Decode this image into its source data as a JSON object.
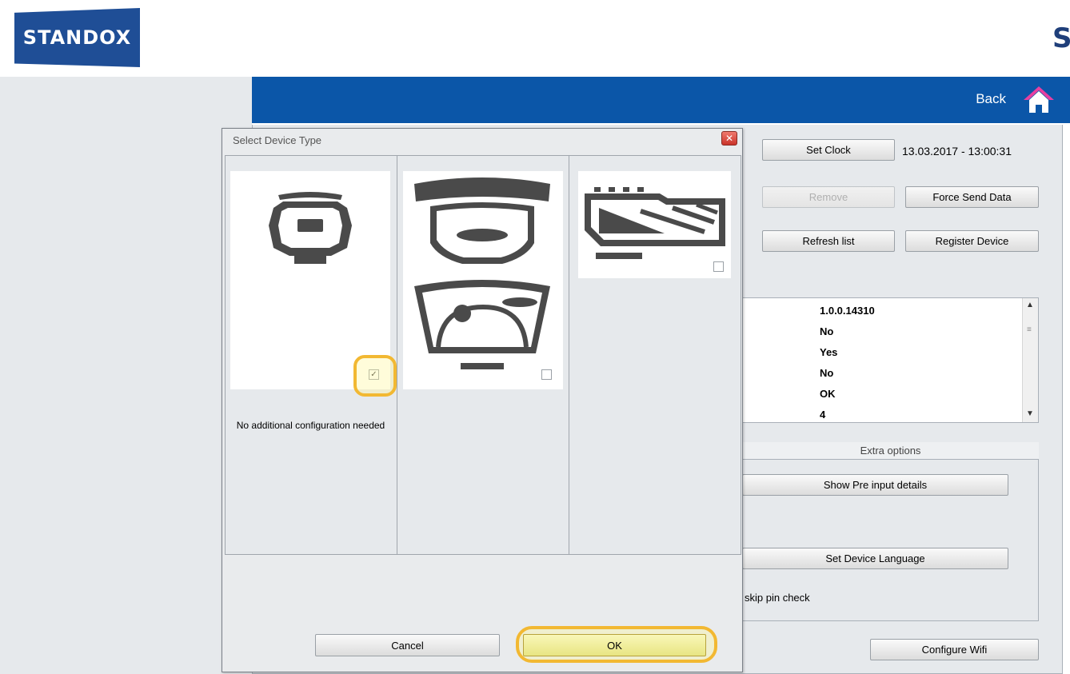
{
  "brand": {
    "logo_text": "STANDOX",
    "corner_letter": "S"
  },
  "header": {
    "back_label": "Back"
  },
  "device_panel": {
    "set_clock_label": "Set Clock",
    "clock_value": "13.03.2017 - 13:00:31",
    "remove_label": "Remove",
    "force_send_label": "Force Send Data",
    "refresh_label": "Refresh list",
    "register_label": "Register Device",
    "info_values": [
      "1.0.0.14310",
      "No",
      "Yes",
      "No",
      "OK",
      "4"
    ],
    "extra_options_label": "Extra options",
    "show_pre_input_label": "Show Pre input details",
    "set_language_label": "Set Device Language",
    "skip_pin_label": "skip pin check",
    "configure_wifi_label": "Configure Wifi"
  },
  "dialog": {
    "title": "Select Device Type",
    "close_icon": "close-icon",
    "caption": "No additional configuration needed",
    "devices": [
      {
        "icon": "handheld-device-icon",
        "checked": true
      },
      {
        "icon": "scale-device-icon",
        "checked": false
      },
      {
        "icon": "spectro-device-icon",
        "checked": false
      }
    ],
    "cancel_label": "Cancel",
    "ok_label": "OK"
  },
  "colors": {
    "brand_blue": "#1f4e96",
    "header_blue": "#0b56a8",
    "highlight": "#f2b832",
    "device_gray": "#4a4a4a"
  }
}
